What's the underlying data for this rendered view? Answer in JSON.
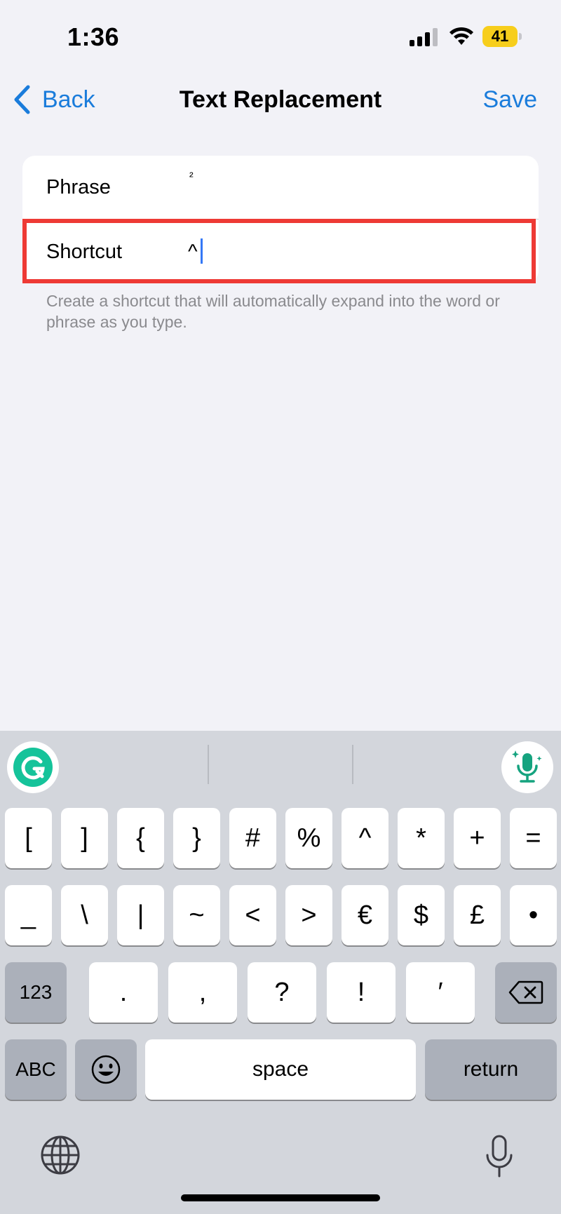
{
  "status_bar": {
    "time": "1:36",
    "battery_level": "41",
    "battery_color": "#F7CE1C",
    "signal_bars_active": 3
  },
  "nav": {
    "back_label": "Back",
    "title": "Text Replacement",
    "save_label": "Save",
    "accent_color": "#1A7CDB"
  },
  "form": {
    "phrase_label": "Phrase",
    "phrase_value": "²",
    "shortcut_label": "Shortcut",
    "shortcut_value": "^",
    "footnote": "Create a shortcut that will automatically expand into the word or phrase as you type."
  },
  "keyboard": {
    "row1": [
      "[",
      "]",
      "{",
      "}",
      "#",
      "%",
      "^",
      "*",
      "+",
      "="
    ],
    "row2": [
      "_",
      "\\",
      "|",
      "~",
      "<",
      ">",
      "€",
      "$",
      "£",
      "•"
    ],
    "row3_mode": "123",
    "row3": [
      ".",
      ",",
      "?",
      "!",
      "′"
    ],
    "abc_label": "ABC",
    "space_label": "space",
    "return_label": "return"
  },
  "icons": [
    "chevron-left-icon",
    "signal-icon",
    "wifi-icon",
    "battery-icon",
    "grammarly-icon",
    "dictation-mic-icon",
    "delete-icon",
    "emoji-icon",
    "globe-icon",
    "mic-icon"
  ],
  "highlight_color": "#EE3A35"
}
